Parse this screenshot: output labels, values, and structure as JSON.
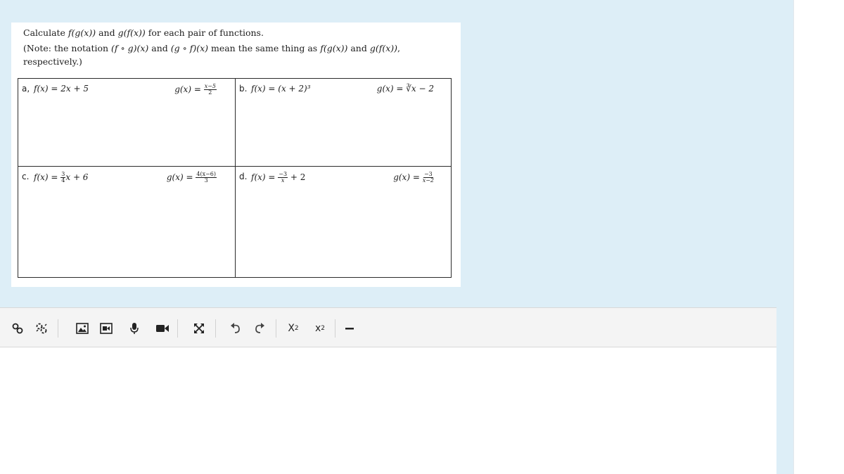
{
  "question": {
    "line1_prefix": "Calculate ",
    "line1_math1": "f(g(x))",
    "line1_mid": " and ",
    "line1_math2": "g(f(x))",
    "line1_suffix": " for each pair of functions.",
    "line2_prefix": "(Note: the notation ",
    "line2_math1": "(f ∘ g)(x)",
    "line2_mid1": " and ",
    "line2_math2": "(g ∘ f)(x)",
    "line2_mid2": " mean the same thing as ",
    "line2_math3": "f(g(x))",
    "line2_mid3": " and ",
    "line2_math4": "g(f(x))",
    "line2_suffix": ",",
    "line3": "respectively.)"
  },
  "problems": {
    "a": {
      "letter": "a,",
      "f": "f(x) = 2x + 5",
      "g_lhs": "g(x) = ",
      "g_num": "x−5",
      "g_den": "2"
    },
    "b": {
      "letter": "b.",
      "f": "f(x) = (x + 2)³",
      "g": "g(x) = ∛x − 2"
    },
    "c": {
      "letter": "c.",
      "f_lhs": "f(x) = ",
      "f_num": "3",
      "f_den": "4",
      "f_rhs": "x + 6",
      "g_lhs": "g(x) = ",
      "g_num": "4(x−6)",
      "g_den": "3"
    },
    "d": {
      "letter": "d.",
      "f_lhs": "f(x) = ",
      "f_num": "−3",
      "f_den": "x",
      "f_rhs": " + 2",
      "g_lhs": "g(x) = ",
      "g_num": "−3",
      "g_den": "x−2"
    }
  },
  "toolbar": {
    "link": "link-icon",
    "unlink": "unlink-icon",
    "image": "image-icon",
    "media": "media-icon",
    "microphone": "microphone-icon",
    "video": "video-icon",
    "fullscreen": "fullscreen-icon",
    "undo": "undo-icon",
    "redo": "redo-icon",
    "subscript_label": "X",
    "subscript_suffix": "2",
    "superscript_label": "x",
    "superscript_suffix": "2",
    "horizontal_rule": "horizontal-rule-icon"
  },
  "colors": {
    "page_background": "#ddeef7",
    "toolbar_background": "#f4f4f4",
    "text": "#1d1d1d"
  }
}
